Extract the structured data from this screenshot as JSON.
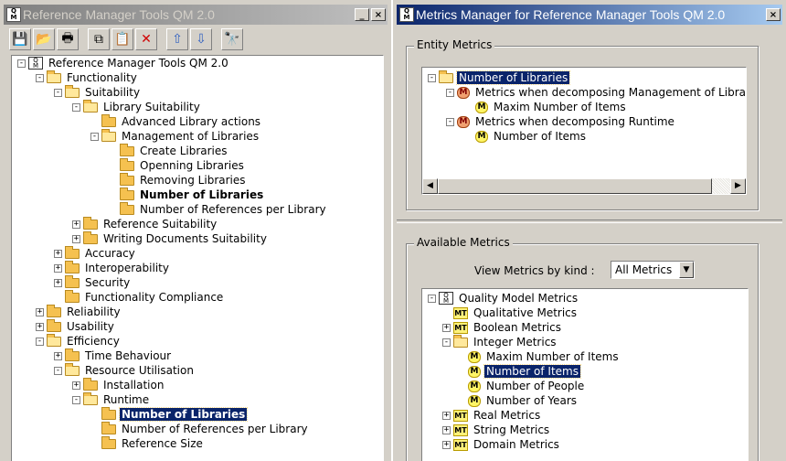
{
  "left_window": {
    "title": "Reference Manager Tools QM 2.0",
    "toolbar": [
      {
        "name": "save-icon",
        "glyph": "💾"
      },
      {
        "name": "open-icon",
        "glyph": "📂"
      },
      {
        "name": "print-icon",
        "glyph": "🖶"
      },
      {
        "name": "copy-icon",
        "glyph": "⧉"
      },
      {
        "name": "paste-icon",
        "glyph": "📋"
      },
      {
        "name": "delete-icon",
        "glyph": "✕"
      },
      {
        "name": "move-up-icon",
        "glyph": "⇧"
      },
      {
        "name": "move-down-icon",
        "glyph": "⇩"
      },
      {
        "name": "find-icon",
        "glyph": "🔭"
      }
    ],
    "tree": [
      {
        "label": "Reference Manager Tools QM 2.0",
        "depth": 0,
        "exp": "-",
        "icon": "model"
      },
      {
        "label": "Functionality",
        "depth": 1,
        "exp": "-",
        "icon": "folder-open"
      },
      {
        "label": "Suitability",
        "depth": 2,
        "exp": "-",
        "icon": "folder-open"
      },
      {
        "label": "Library Suitability",
        "depth": 3,
        "exp": "-",
        "icon": "folder-open"
      },
      {
        "label": "Advanced Library actions",
        "depth": 4,
        "exp": "",
        "icon": "folder"
      },
      {
        "label": "Management of Libraries",
        "depth": 4,
        "exp": "-",
        "icon": "folder-open"
      },
      {
        "label": "Create Libraries",
        "depth": 5,
        "exp": "",
        "icon": "folder"
      },
      {
        "label": "Openning Libraries",
        "depth": 5,
        "exp": "",
        "icon": "folder"
      },
      {
        "label": "Removing Libraries",
        "depth": 5,
        "exp": "",
        "icon": "folder"
      },
      {
        "label": "Number of Libraries",
        "depth": 5,
        "exp": "",
        "icon": "folder",
        "bold": true
      },
      {
        "label": "Number of References per Library",
        "depth": 5,
        "exp": "",
        "icon": "folder"
      },
      {
        "label": "Reference Suitability",
        "depth": 3,
        "exp": "+",
        "icon": "folder"
      },
      {
        "label": "Writing Documents Suitability",
        "depth": 3,
        "exp": "+",
        "icon": "folder"
      },
      {
        "label": "Accuracy",
        "depth": 2,
        "exp": "+",
        "icon": "folder"
      },
      {
        "label": "Interoperability",
        "depth": 2,
        "exp": "+",
        "icon": "folder"
      },
      {
        "label": "Security",
        "depth": 2,
        "exp": "+",
        "icon": "folder"
      },
      {
        "label": "Functionality Compliance",
        "depth": 2,
        "exp": "",
        "icon": "folder"
      },
      {
        "label": "Reliability",
        "depth": 1,
        "exp": "+",
        "icon": "folder"
      },
      {
        "label": "Usability",
        "depth": 1,
        "exp": "+",
        "icon": "folder"
      },
      {
        "label": "Efficiency",
        "depth": 1,
        "exp": "-",
        "icon": "folder-open"
      },
      {
        "label": "Time Behaviour",
        "depth": 2,
        "exp": "+",
        "icon": "folder"
      },
      {
        "label": "Resource Utilisation",
        "depth": 2,
        "exp": "-",
        "icon": "folder-open"
      },
      {
        "label": "Installation",
        "depth": 3,
        "exp": "+",
        "icon": "folder"
      },
      {
        "label": "Runtime",
        "depth": 3,
        "exp": "-",
        "icon": "folder-open"
      },
      {
        "label": "Number of Libraries",
        "depth": 4,
        "exp": "",
        "icon": "folder",
        "bold": true,
        "selected": true
      },
      {
        "label": "Number of References per Library",
        "depth": 4,
        "exp": "",
        "icon": "folder"
      },
      {
        "label": "Reference Size",
        "depth": 4,
        "exp": "",
        "icon": "folder"
      }
    ]
  },
  "right_window": {
    "title": "Metrics Manager for Reference Manager Tools QM 2.0",
    "entity_metrics": {
      "title": "Entity Metrics",
      "tree": [
        {
          "label": "Number of Libraries",
          "depth": 0,
          "exp": "-",
          "icon": "folder-open",
          "selected": true
        },
        {
          "label": "Metrics when decomposing Management of Libraries",
          "depth": 1,
          "exp": "-",
          "icon": "m-red"
        },
        {
          "label": "Maxim Number of Items",
          "depth": 2,
          "exp": "",
          "icon": "m"
        },
        {
          "label": "Metrics when decomposing Runtime",
          "depth": 1,
          "exp": "-",
          "icon": "m-red"
        },
        {
          "label": "Number of Items",
          "depth": 2,
          "exp": "",
          "icon": "m"
        }
      ]
    },
    "available_metrics": {
      "title": "Available Metrics",
      "view_label": "View Metrics by kind :",
      "view_value": "All Metrics",
      "tree": [
        {
          "label": "Quality Model Metrics",
          "depth": 0,
          "exp": "-",
          "icon": "model"
        },
        {
          "label": "Qualitative Metrics",
          "depth": 1,
          "exp": "",
          "icon": "mt"
        },
        {
          "label": "Boolean Metrics",
          "depth": 1,
          "exp": "+",
          "icon": "mt"
        },
        {
          "label": "Integer Metrics",
          "depth": 1,
          "exp": "-",
          "icon": "folder-open"
        },
        {
          "label": "Maxim Number of Items",
          "depth": 2,
          "exp": "",
          "icon": "m"
        },
        {
          "label": "Number of Items",
          "depth": 2,
          "exp": "",
          "icon": "m",
          "selected": true
        },
        {
          "label": "Number of People",
          "depth": 2,
          "exp": "",
          "icon": "m"
        },
        {
          "label": "Number of Years",
          "depth": 2,
          "exp": "",
          "icon": "m"
        },
        {
          "label": "Real Metrics",
          "depth": 1,
          "exp": "+",
          "icon": "mt"
        },
        {
          "label": "String Metrics",
          "depth": 1,
          "exp": "+",
          "icon": "mt"
        },
        {
          "label": "Domain Metrics",
          "depth": 1,
          "exp": "+",
          "icon": "mt"
        }
      ]
    }
  },
  "window_buttons": {
    "minimize": "_",
    "close": "×"
  }
}
